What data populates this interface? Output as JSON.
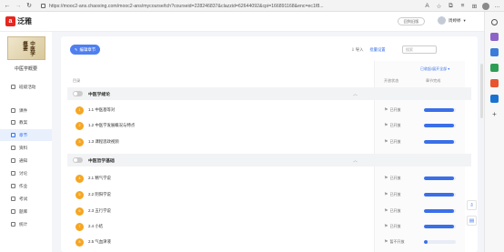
{
  "browser": {
    "url": "https://mooc2-ans.chaoxing.com/mooc2-ans/mycourse/tch?courseid=228246837&clazzid=62644092&cpi=166891168&enc=ec1f8..."
  },
  "header": {
    "logo_text": "泛雅",
    "center_button": "回到旧版",
    "user_name": "周婷婷"
  },
  "course": {
    "cover_title": "中医学概要",
    "name": "中医学概要"
  },
  "nav": [
    {
      "label": "班级活动",
      "active": false
    },
    {
      "label": "课件",
      "active": false
    },
    {
      "label": "教案",
      "active": false
    },
    {
      "label": "章节",
      "active": true
    },
    {
      "label": "资料",
      "active": false
    },
    {
      "label": "通知",
      "active": false
    },
    {
      "label": "讨论",
      "active": false
    },
    {
      "label": "作业",
      "active": false
    },
    {
      "label": "考试",
      "active": false
    },
    {
      "label": "题库",
      "active": false
    },
    {
      "label": "统计",
      "active": false
    }
  ],
  "toolbar": {
    "edit_label": "编辑章节",
    "import_label": "导入",
    "settings_label": "批量设置",
    "search_placeholder": "搜索"
  },
  "table": {
    "col_chapter": "目录",
    "col_status": "开放状态",
    "col_progress": "章节完成",
    "expand_all": "已收起/展开全部"
  },
  "rows": [
    {
      "kind": "chapter",
      "title": "中医学绪论"
    },
    {
      "kind": "lesson",
      "num": "1",
      "title": "1.1 中医基等对",
      "status": "已开放",
      "progress": 0.95
    },
    {
      "kind": "lesson",
      "num": "2",
      "title": "1.2 中医学发展概况与特点",
      "status": "已开放",
      "progress": 0.95
    },
    {
      "kind": "lesson",
      "num": "3",
      "title": "1.3 课程思政视频",
      "status": "已开放",
      "progress": 0.95
    },
    {
      "kind": "chapter",
      "title": "中医哲学基础"
    },
    {
      "kind": "lesson",
      "num": "4",
      "title": "2.1 精气学说",
      "status": "已开放",
      "progress": 0.95
    },
    {
      "kind": "lesson",
      "num": "5",
      "title": "2.2 阴阳学说",
      "status": "已开放",
      "progress": 0.95
    },
    {
      "kind": "lesson",
      "num": "6",
      "title": "2.3 五行学说",
      "status": "已开放",
      "progress": 0.95
    },
    {
      "kind": "lesson",
      "num": "7",
      "title": "2.4 小结",
      "status": "已开放",
      "progress": 0.95
    },
    {
      "kind": "lesson",
      "num": "8",
      "title": "2.5 气血津液",
      "status": "暂不开放",
      "progress": 0.1
    }
  ]
}
